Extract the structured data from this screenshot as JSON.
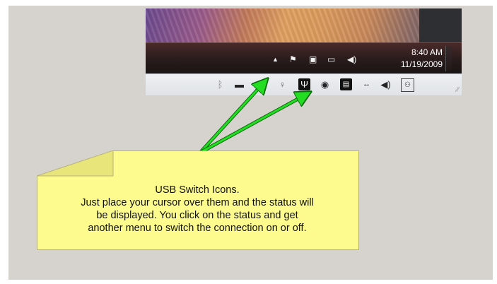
{
  "taskbar": {
    "time": "8:40 AM",
    "date": "11/19/2009",
    "tray_icons": [
      "show-hidden-icons-arrow-icon",
      "action-center-flag-icon",
      "power-plug-icon",
      "network-monitor-icon",
      "volume-speaker-icon"
    ]
  },
  "overflow_tray": {
    "icons": [
      "bluetooth-icon",
      "drive-icon",
      "usb-trident-icon",
      "webcam-icon",
      "usb-device-icon",
      "disc-drive-icon",
      "hard-disk-icon",
      "network-arrows-icon",
      "speaker-icon",
      "network-share-icon"
    ]
  },
  "annotation": {
    "arrow_color": "#22dd22",
    "lines": [
      "USB Switch Icons.",
      "Just place your cursor over them and the status will",
      "be displayed. You click on the status and get",
      "another menu to switch the connection on or off."
    ]
  },
  "colors": {
    "background": "#d6d3ce",
    "note": "#fdfb8e",
    "taskbar": "#2a1c1c"
  }
}
